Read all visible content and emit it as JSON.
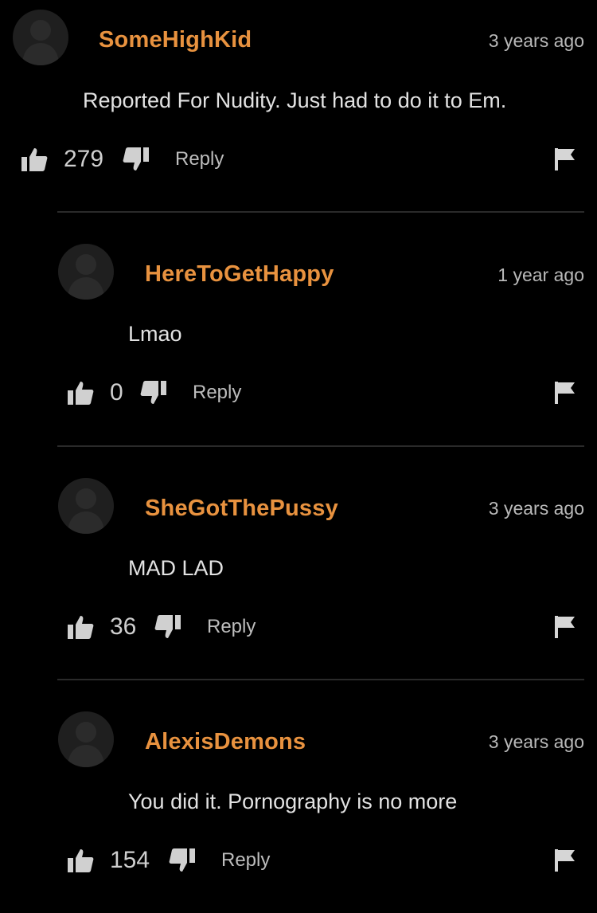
{
  "comments": [
    {
      "username": "SomeHighKid",
      "time": "3 years ago",
      "text": "Reported For Nudity. Just had to do it to Em.",
      "likes": "279",
      "reply_label": "Reply"
    },
    {
      "username": "HereToGetHappy",
      "time": "1 year ago",
      "text": "Lmao",
      "likes": "0",
      "reply_label": "Reply"
    },
    {
      "username": "SheGotThePussy",
      "time": "3 years ago",
      "text": "MAD LAD",
      "likes": "36",
      "reply_label": "Reply"
    },
    {
      "username": "AlexisDemons",
      "time": "3 years ago",
      "text": "You did it. Pornography is no more",
      "likes": "154",
      "reply_label": "Reply"
    }
  ],
  "colors": {
    "background": "#000000",
    "username": "#e8923f",
    "avatar": "#1f1f1f",
    "divider": "#2a2a2a"
  },
  "icons": [
    "avatar-icon",
    "thumbs-up-icon",
    "thumbs-down-icon",
    "flag-icon"
  ]
}
